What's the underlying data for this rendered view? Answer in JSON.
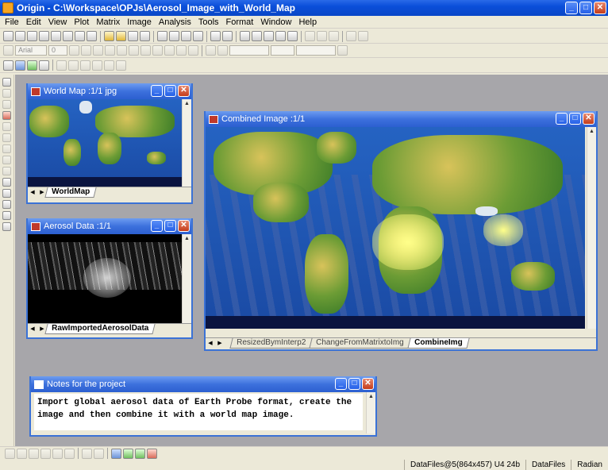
{
  "app": {
    "title": "Origin - C:\\Workspace\\OPJs\\Aerosol_Image_with_World_Map"
  },
  "window_controls": {
    "minimize": "_",
    "maximize": "□",
    "close": "✕"
  },
  "menu": [
    "File",
    "Edit",
    "View",
    "Plot",
    "Matrix",
    "Image",
    "Analysis",
    "Tools",
    "Format",
    "Window",
    "Help"
  ],
  "format_toolbar": {
    "font_value": "Arial",
    "size_value": "0"
  },
  "windows": {
    "world_map": {
      "title": "World Map :1/1 jpg",
      "tabs": [
        "WorldMap"
      ],
      "active_tab": 0
    },
    "aerosol": {
      "title": "Aerosol Data :1/1",
      "tabs": [
        "RawImportedAerosolData"
      ],
      "active_tab": 0
    },
    "combined": {
      "title": "Combined Image :1/1",
      "tabs": [
        "ResizedBymInterp2",
        "ChangeFromMatrixtoImg",
        "CombineImg"
      ],
      "active_tab": 2
    },
    "notes": {
      "title": "Notes for the project",
      "text": "Import global aerosol data of Earth Probe format, create the image and then combine it with a world map image."
    }
  },
  "status": {
    "info": "DataFiles@5(864x457) U4 24b",
    "folder": "DataFiles",
    "angle_unit": "Radian"
  },
  "colors": {
    "titlebar": "#0a4ed9",
    "workspace": "#a7a6aa",
    "ocean": "#1a4aa4"
  }
}
